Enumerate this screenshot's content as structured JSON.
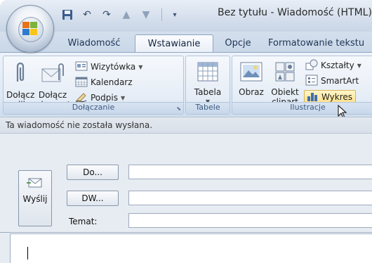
{
  "window": {
    "title": "Bez tytułu - Wiadomość (HTML)"
  },
  "tabs": [
    {
      "label": "Wiadomość",
      "active": false
    },
    {
      "label": "Wstawianie",
      "active": true
    },
    {
      "label": "Opcje",
      "active": false
    },
    {
      "label": "Formatowanie tekstu",
      "active": false
    }
  ],
  "ribbon": {
    "groups": {
      "dolaczanie": {
        "label": "Dołączanie",
        "attach_file": "Dołącz\nplik",
        "attach_file_l1": "Dołącz",
        "attach_file_l2": "plik",
        "attach_item_l1": "Dołącz",
        "attach_item_l2": "element",
        "business_card": "Wizytówka",
        "calendar": "Kalendarz",
        "signature": "Podpis"
      },
      "tabele": {
        "label": "Tabele",
        "table": "Tabela"
      },
      "ilustracje": {
        "label": "Ilustracje",
        "picture": "Obraz",
        "clipart_l1": "Obiekt",
        "clipart_l2": "clipart",
        "shapes": "Kształty",
        "smartart": "SmartArt",
        "chart": "Wykres"
      }
    }
  },
  "message": {
    "notice": "Ta wiadomość nie została wysłana.",
    "send": "Wyślij",
    "to_button": "Do...",
    "cc_button": "DW...",
    "subject_label": "Temat:",
    "to_value": "",
    "cc_value": "",
    "subject_value": ""
  }
}
